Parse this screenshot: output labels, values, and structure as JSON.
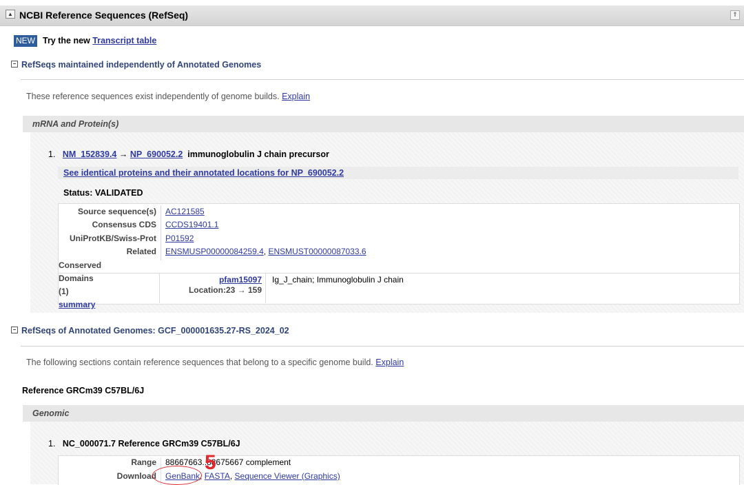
{
  "panel": {
    "title": "NCBI Reference Sequences (RefSeq)",
    "collapse_glyph": "▲",
    "scroll_glyph": "⇑"
  },
  "promo": {
    "badge": "NEW",
    "text": "Try the new",
    "link": "Transcript table"
  },
  "section1": {
    "toggle": "−",
    "title": "RefSeqs maintained independently of Annotated Genomes",
    "desc": "These reference sequences exist independently of genome builds.",
    "explain": "Explain",
    "subheader": "mRNA and Protein(s)",
    "item": {
      "num": "1.",
      "nm": "NM_152839.4",
      "arrow": "→",
      "np": "NP_690052.2",
      "name": "immunoglobulin J chain precursor",
      "identical_link": "See identical proteins and their annotated locations for NP_690052.2",
      "status": "Status: VALIDATED",
      "rows": [
        {
          "label": "Source sequence(s)",
          "values": [
            "AC121585"
          ]
        },
        {
          "label": "Consensus CDS",
          "values": [
            "CCDS19401.1"
          ]
        },
        {
          "label": "UniProtKB/Swiss-Prot",
          "values": [
            "P01592"
          ]
        },
        {
          "label": "Related",
          "values": [
            "ENSMUSP00000084259.4",
            "ENSMUST00000087033.6"
          ]
        }
      ],
      "conserved": {
        "label": "Conserved Domains (1)",
        "link": "summary",
        "domain_id": "pfam15097",
        "domain_desc": "Ig_J_chain; Immunoglobulin J chain",
        "location": "Location:23 → 159"
      }
    }
  },
  "section2": {
    "toggle": "−",
    "title": "RefSeqs of Annotated Genomes: GCF_000001635.27-RS_2024_02",
    "desc": "The following sections contain reference sequences that belong to a specific genome build.",
    "explain": "Explain",
    "reference": "Reference GRCm39 C57BL/6J",
    "subheader": "Genomic",
    "item": {
      "num": "1.",
      "title": "NC_000071.7 Reference GRCm39 C57BL/6J",
      "range_label": "Range",
      "range_value": "88667663..88675667 complement",
      "download_label": "Download",
      "downloads": [
        "GenBank",
        "FASTA",
        "Sequence Viewer (Graphics)"
      ]
    }
  },
  "annotation": {
    "label": "5",
    "color": "#e0282e"
  }
}
